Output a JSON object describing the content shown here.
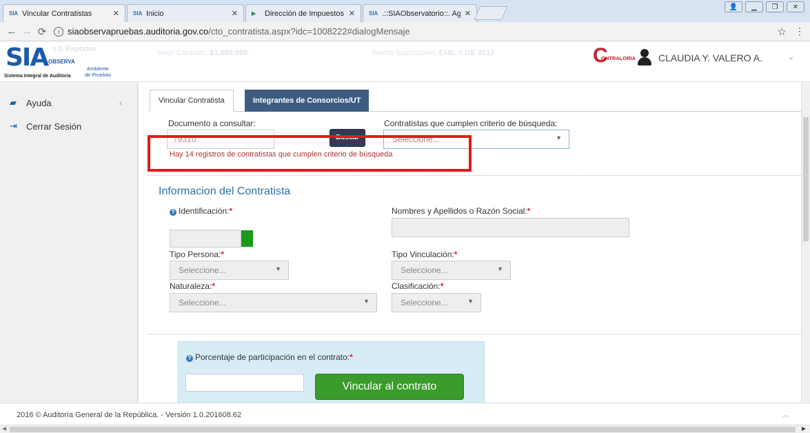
{
  "browser": {
    "tabs": [
      {
        "favicon": "SIA",
        "title": "Vincular Contratistas"
      },
      {
        "favicon": "SIA",
        "title": "Inicio"
      },
      {
        "favicon": "doc",
        "title": "Dirección de Impuestos y A"
      },
      {
        "favicon": "SIA",
        "title": ".::SIAObservatorio::. Agreg"
      }
    ],
    "url_host": "siaobservapruebas.auditoria.gov.co",
    "url_path": "/cto_contratista.aspx?idc=1008222#dialogMensaje"
  },
  "header": {
    "logo_text": "SIA",
    "logo_observa": "OBSERVA",
    "logo_subtitle": "Sistema Integral de Auditoría",
    "logo_env": "Ambiente de Pruebas",
    "ghost_menu": "s & Reportes",
    "valor_label": "Valor Contrato:",
    "valor_value": "$1.500.000",
    "fecha_label": "Fecha Suscripción:",
    "fecha_value": "ENE. 1 DE 2017",
    "contraloria": "ONTRALORIA",
    "username": "CLAUDIA Y. VALERO A."
  },
  "sidebar": {
    "items": [
      {
        "label": "Ayuda",
        "icon": "book-icon"
      },
      {
        "label": "Cerrar Sesión",
        "icon": "sign-out-icon"
      }
    ]
  },
  "main": {
    "tabs": [
      "Vincular Contratista",
      "Integrantes de Consorcios/UT"
    ],
    "documento_label": "Documento a consultar:",
    "documento_value": "79310",
    "buscar_label": "Buscar",
    "contratistas_label": "Contratistas que cumplen criterio de búsqueda:",
    "contratistas_select": "Seleccione...",
    "search_message": "Hay 14 registros de contratistas que cumplen criterio de búsqueda",
    "section_title": "Informacion del Contratista",
    "identificacion_label": "Identificación:",
    "nombres_label": "Nombres y Apellidos o Razón Social:",
    "tipo_persona_label": "Tipo Persona:",
    "tipo_persona_value": "Seleccione...",
    "tipo_vinculacion_label": "Tipo Vinculación:",
    "tipo_vinculacion_value": "Seleccione...",
    "naturaleza_label": "Naturaleza:",
    "naturaleza_value": "Seleccione...",
    "clasificacion_label": "Clasificación:",
    "clasificacion_value": "Seleccione...",
    "porcentaje_label": "Porcentaje de participación en el contrato:",
    "vincular_button": "Vincular al contrato",
    "required_mark": "*"
  },
  "footer": {
    "text": "2016 © Auditoría General de la República. - Versión 1.0.201608.62"
  },
  "colors": {
    "accent": "#1d5ba8",
    "highlight_border": "#e21a1a",
    "primary_button": "#3a9c2a",
    "tab_inactive": "#3e5c80"
  }
}
